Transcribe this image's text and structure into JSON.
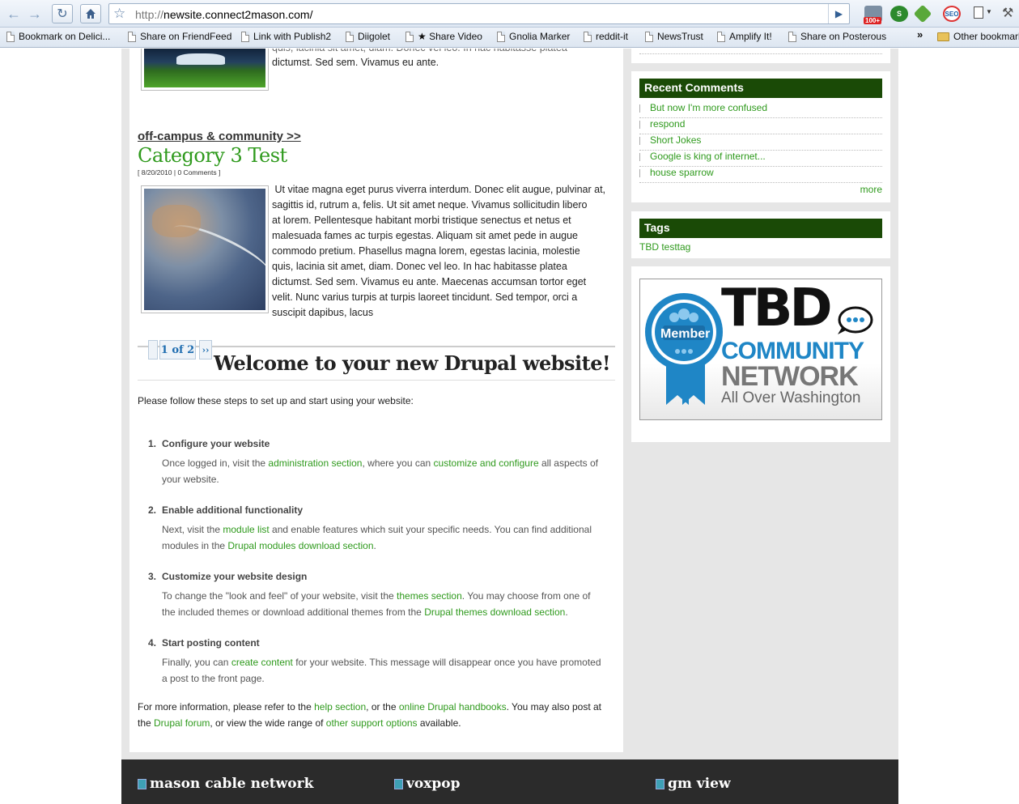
{
  "browser": {
    "url_prefix": "http://",
    "url_host": "newsite.connect2mason.com/",
    "ext_badge": "100+",
    "bookmarks": [
      {
        "label": "Bookmark on Delici..."
      },
      {
        "label": "Share on FriendFeed"
      },
      {
        "label": "Link with Publish2"
      },
      {
        "label": "Diigolet"
      },
      {
        "label": "★ Share Video"
      },
      {
        "label": "Gnolia Marker"
      },
      {
        "label": "reddit-it"
      },
      {
        "label": "NewsTrust"
      },
      {
        "label": "Amplify It!"
      },
      {
        "label": "Share on Posterous"
      }
    ],
    "bookmarks_overflow": "»",
    "other_bookmarks": "Other bookmarks"
  },
  "post_top": {
    "tail_text_line1": "quis, lacinia sit amet, diam. Donec vel leo. In hac habitasse platea",
    "tail_text_line2": "dictumst. Sed sem. Vivamus eu ante."
  },
  "post": {
    "category_link": "off-campus & community >>",
    "title": "Category 3 Test",
    "meta": "[ 8/20/2010 | 0 Comments ]",
    "body_lines": [
      " Ut vitae magna eget purus viverra interdum. Donec elit augue, pulvinar at,",
      "sagittis id, rutrum a, felis. Ut sit amet neque. Vivamus sollicitudin libero",
      "at lorem. Pellentesque habitant morbi tristique senectus et netus et",
      "malesuada fames ac turpis egestas. Aliquam sit amet pede in augue",
      "commodo pretium. Phasellus magna lorem, egestas lacinia, molestie",
      "quis, lacinia sit amet, diam. Donec vel leo. In hac habitasse platea",
      "dictumst. Sed sem. Vivamus eu ante. Maecenas accumsan tortor eget",
      "velit. Nunc varius turpis at turpis laoreet tincidunt. Sed tempor, orci a",
      "suscipit dapibus, lacus"
    ]
  },
  "pager": {
    "current": "1 of 2",
    "next": "››"
  },
  "welcome": {
    "title": "Welcome to your new Drupal website!",
    "intro": "Please follow these steps to set up and start using your website:",
    "steps": [
      {
        "num": "1.",
        "title": "Configure your website",
        "l1a": "Once logged in, visit the ",
        "l1b": "administration section",
        "l1c": ", where you can ",
        "l1d": "customize and configure",
        "l1e": " all aspects of",
        "l2": "your website."
      },
      {
        "num": "2.",
        "title": "Enable additional functionality",
        "l1a": "Next, visit the ",
        "l1b": "module list",
        "l1c": " and enable features which suit your specific needs. You can find additional",
        "l2a": "modules in the ",
        "l2b": "Drupal modules download section",
        "l2c": "."
      },
      {
        "num": "3.",
        "title": "Customize your website design",
        "l1a": "To change the \"look and feel\" of your website, visit the ",
        "l1b": "themes section",
        "l1c": ". You may choose from one of",
        "l2a": "the included themes or download additional themes from the ",
        "l2b": "Drupal themes download section",
        "l2c": "."
      },
      {
        "num": "4.",
        "title": "Start posting content",
        "l1a": "Finally, you can ",
        "l1b": "create content",
        "l1c": " for your website. This message will disappear once you have promoted",
        "l2": "a post to the front page."
      }
    ],
    "outro": {
      "a": "For more information, please refer to the ",
      "b": "help section",
      "c": ", or the ",
      "d": "online Drupal handbooks",
      "e": ". You may also post at",
      "f": "the ",
      "g": "Drupal forum",
      "h": ", or view the wide range of ",
      "i": "other support options",
      "j": " available."
    }
  },
  "sidebar": {
    "recent_comments": {
      "title": "Recent Comments",
      "items": [
        "But now I'm more confused",
        "respond",
        "Short Jokes",
        "Google is king of internet...",
        "house sparrow"
      ],
      "more": "more"
    },
    "tags": {
      "title": "Tags",
      "items": [
        "TBD testtag"
      ]
    },
    "badge": {
      "member": "Member",
      "tbd": "TBD",
      "community": "COMMUNITY",
      "network": "NETWORK",
      "tagline": "All Over Washington"
    }
  },
  "footer": {
    "columns": [
      {
        "title": "mason cable network"
      },
      {
        "title": "voxpop"
      },
      {
        "title": "gm view"
      }
    ]
  },
  "colors": {
    "accent": "#2f9a1d",
    "header_green": "#1a4a06",
    "footer_bg": "#2b2b2b",
    "badge_blue": "#1f86c6"
  }
}
